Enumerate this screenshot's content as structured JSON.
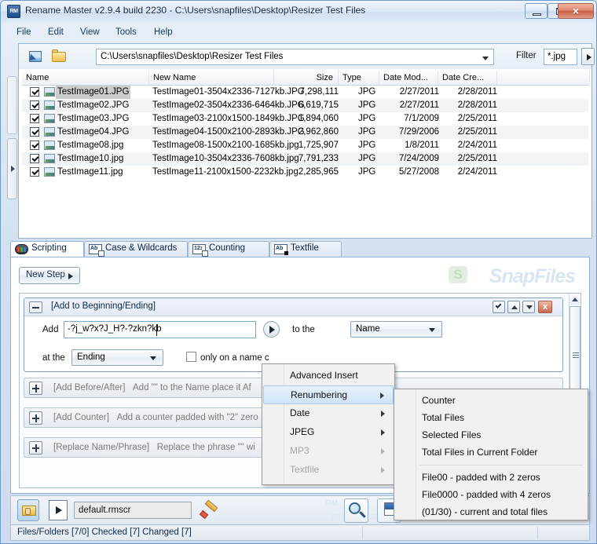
{
  "window": {
    "title": "Rename Master v2.9.4 build 2230 - C:\\Users\\snapfiles\\Desktop\\Resizer Test Files",
    "app_icon": "RM",
    "minimize": "minimize-icon",
    "maximize": "maximize-icon",
    "close": "×"
  },
  "menubar": {
    "items": [
      "File",
      "Edit",
      "View",
      "Tools",
      "Help"
    ]
  },
  "pathbar": {
    "path": "C:\\Users\\snapfiles\\Desktop\\Resizer Test Files",
    "filter_label": "Filter",
    "filter_value": "*.jpg"
  },
  "filelist": {
    "columns": [
      "Name",
      "New Name",
      "Size",
      "Type",
      "Date Mod...",
      "Date Cre..."
    ],
    "rows": [
      {
        "checked": true,
        "name": "TestImage01.JPG",
        "new_name": "TestImage01-3504x2336-7127kb.JPG",
        "size": "7,298,111",
        "type": "JPG",
        "modified": "2/27/2011",
        "created": "2/28/2011",
        "selected": true
      },
      {
        "checked": true,
        "name": "TestImage02.JPG",
        "new_name": "TestImage02-3504x2336-6464kb.JPG",
        "size": "6,619,715",
        "type": "JPG",
        "modified": "2/27/2011",
        "created": "2/28/2011",
        "selected": false
      },
      {
        "checked": true,
        "name": "TestImage03.JPG",
        "new_name": "TestImage03-2100x1500-1849kb.JPG",
        "size": "1,894,060",
        "type": "JPG",
        "modified": "7/1/2009",
        "created": "2/25/2011",
        "selected": false
      },
      {
        "checked": true,
        "name": "TestImage04.JPG",
        "new_name": "TestImage04-1500x2100-2893kb.JPG",
        "size": "2,962,860",
        "type": "JPG",
        "modified": "7/29/2006",
        "created": "2/25/2011",
        "selected": false
      },
      {
        "checked": true,
        "name": "TestImage08.jpg",
        "new_name": "TestImage08-1500x2100-1685kb.jpg",
        "size": "1,725,907",
        "type": "JPG",
        "modified": "1/8/2011",
        "created": "2/24/2011",
        "selected": false
      },
      {
        "checked": true,
        "name": "TestImage10.jpg",
        "new_name": "TestImage10-3504x2336-7608kb.jpg",
        "size": "7,791,233",
        "type": "JPG",
        "modified": "7/24/2009",
        "created": "2/25/2011",
        "selected": false
      },
      {
        "checked": true,
        "name": "TestImage11.jpg",
        "new_name": "TestImage11-2100x1500-2232kb.jpg",
        "size": "2,285,965",
        "type": "JPG",
        "modified": "5/27/2008",
        "created": "2/24/2011",
        "selected": false
      }
    ]
  },
  "tabs": [
    {
      "label": "Scripting",
      "icon": "film-strip-icon",
      "active": true
    },
    {
      "label": "Case & Wildcards",
      "icon": "ab-page-icon",
      "active": false
    },
    {
      "label": "Counting",
      "icon": "123-page-icon",
      "active": false
    },
    {
      "label": "Textfile",
      "icon": "ab-block-icon",
      "active": false
    }
  ],
  "script_panel": {
    "new_step_label": "New Step",
    "watermark": "SnapFiles",
    "watermark_logo": "S",
    "open_step": {
      "title": "[Add to Beginning/Ending]",
      "add_label": "Add",
      "add_value": "-?j_w?x?J_H?-?zkn?kb",
      "to_the_label": "to the",
      "to_the_value": "Name",
      "at_the_label": "at the",
      "at_the_value": "Ending",
      "only_label": "only on a name c",
      "only_checked": false
    },
    "closed_steps": [
      {
        "title": "[Add Before/After]",
        "rest": "Add  \"\"  to the  Name  place it  Af"
      },
      {
        "title": "[Add Counter]",
        "rest": "Add a counter padded with  \"2\"  zero"
      },
      {
        "title": "[Replace Name/Phrase]",
        "rest": "Replace the  phrase  \"\"  wi"
      }
    ]
  },
  "context_menu": {
    "items": [
      {
        "label": "Advanced Insert",
        "submenu": false,
        "disabled": false,
        "highlighted": false
      },
      {
        "label": "Renumbering",
        "submenu": true,
        "disabled": false,
        "highlighted": true
      },
      {
        "label": "Date",
        "submenu": true,
        "disabled": false,
        "highlighted": false
      },
      {
        "label": "JPEG",
        "submenu": true,
        "disabled": false,
        "highlighted": false
      },
      {
        "label": "MP3",
        "submenu": true,
        "disabled": true,
        "highlighted": false
      },
      {
        "label": "Textfile",
        "submenu": true,
        "disabled": true,
        "highlighted": false
      }
    ]
  },
  "submenu": {
    "items_top": [
      "Counter",
      "Total Files",
      "Selected Files",
      "Total Files in Current Folder"
    ],
    "items_bottom": [
      "File00 - padded with 2 zeros",
      "File0000 - padded with 4 zeros",
      "(01/30) - current and total files"
    ]
  },
  "bottombar": {
    "script_name": "default.rmscr",
    "save_icon": "save-script-icon",
    "run_icon": "run-script-icon",
    "erase_icon": "eraser-icon",
    "preview_icon": "preview-magnifier-icon",
    "rename_icon": "rename-apply-icon",
    "watermark": "RM"
  },
  "statusbar": {
    "text": "Files/Folders [7/0] Checked [7] Changed [7]"
  }
}
